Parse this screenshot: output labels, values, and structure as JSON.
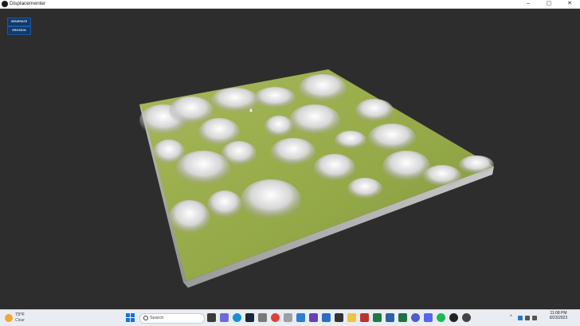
{
  "window": {
    "title": "Displacementer",
    "min": "–",
    "max": "▢",
    "close": "✕"
  },
  "controls": {
    "generate": "GENERATE",
    "erosion": "EROSION"
  },
  "taskbar": {
    "weather_temp": "73°F",
    "weather_condition": "Clear",
    "search_placeholder": "Search",
    "time": "11:08 PM",
    "date": "8/23/2023",
    "tray_up": "^"
  },
  "icons": [
    "start-icon",
    "search-icon",
    "widgets-icon",
    "chat-icon",
    "edge-icon",
    "steam-icon",
    "files-icon",
    "chrome-icon",
    "settings-icon",
    "photos-icon",
    "vscode-icon",
    "notes-icon",
    "terminal-icon",
    "folder-icon",
    "calendar-icon",
    "app-icon",
    "code-icon",
    "excel-icon",
    "store-icon",
    "discord-icon",
    "spotify-icon",
    "media-icon",
    "unity-icon",
    "obs-icon"
  ],
  "colors": {
    "background": "#2d2d2d",
    "button": "#0f3a6c",
    "terrain_low": "#9aae4c",
    "terrain_high": "#f2f2f2"
  }
}
